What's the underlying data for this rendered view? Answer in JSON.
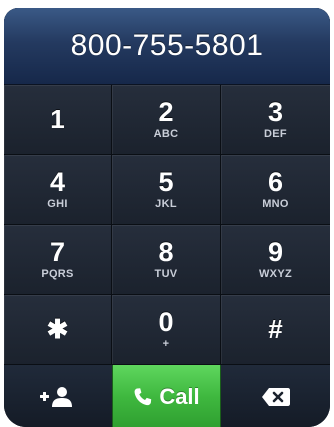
{
  "display": {
    "number": "800-755-5801"
  },
  "keys": [
    {
      "digit": "1",
      "letters": ""
    },
    {
      "digit": "2",
      "letters": "ABC"
    },
    {
      "digit": "3",
      "letters": "DEF"
    },
    {
      "digit": "4",
      "letters": "GHI"
    },
    {
      "digit": "5",
      "letters": "JKL"
    },
    {
      "digit": "6",
      "letters": "MNO"
    },
    {
      "digit": "7",
      "letters": "PQRS"
    },
    {
      "digit": "8",
      "letters": "TUV"
    },
    {
      "digit": "9",
      "letters": "WXYZ"
    },
    {
      "digit": "✱",
      "letters": ""
    },
    {
      "digit": "0",
      "letters": "+"
    },
    {
      "digit": "#",
      "letters": ""
    }
  ],
  "actions": {
    "add_contact_icon": "add-contact-icon",
    "call_label": "Call",
    "call_icon": "phone-icon",
    "delete_icon": "backspace-icon"
  },
  "colors": {
    "call_green": "#3fb83f",
    "display_blue": "#243a60",
    "key_dark": "#1d232f"
  }
}
